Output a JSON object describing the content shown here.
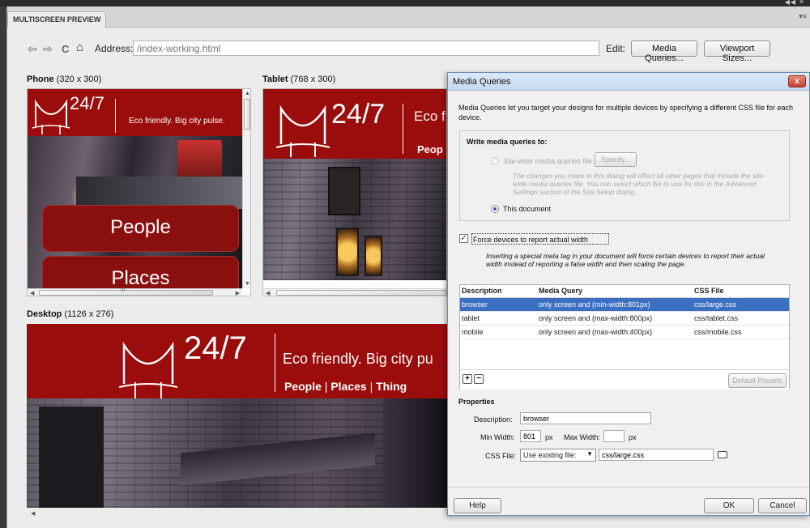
{
  "panel": {
    "tab_label": "MULTISCREEN PREVIEW",
    "window_controls": "◀◀ ✕",
    "panel_menu": "▾≡"
  },
  "toolbar": {
    "back_icon": "⇦",
    "forward_icon": "⇨",
    "refresh_icon": "C",
    "home_icon": "⌂",
    "address_label": "Address:",
    "address_value": "/index-working.html",
    "edit_label": "Edit:",
    "media_queries_button": "Media Queries...",
    "viewport_sizes_button": "Viewport Sizes..."
  },
  "previews": {
    "phone": {
      "name": "Phone",
      "size": "(320 x 300)"
    },
    "tablet": {
      "name": "Tablet",
      "size": "(768 x 300)"
    },
    "desktop": {
      "name": "Desktop",
      "size": "(1126 x 276)"
    }
  },
  "site": {
    "logo_text": "24/7",
    "tagline_phone": "Eco friendly. Big city pulse.",
    "tagline_tablet": "Eco f",
    "tagline_desktop": "Eco friendly. Big city pu",
    "people": "People",
    "places": "Places",
    "nav_people": "People",
    "nav_places": "Places",
    "nav_things": "Thing",
    "nav_people_tablet": "Peop",
    "hscroll_mark": "III"
  },
  "dialog": {
    "title": "Media Queries",
    "close": "x",
    "intro": "Media Queries let you target your designs for multiple devices by specifying a different CSS file for each device.",
    "write_heading": "Write media queries to:",
    "site_wide_label": "Site-wide media queries file:",
    "specify_button": "Specify...",
    "site_wide_note": "The changes you make in this dialog will affect all other pages that include the site-wide media queries file. You can select which file to use for this in the Advanced Settings section of the Site Setup dialog.",
    "this_document_label": "This document",
    "force_label": "Force devices to report actual width",
    "force_note": "Inserting a special meta tag in your document will force certain devices to report their actual width instead of reporting a false width and then scaling the page.",
    "table": {
      "headers": [
        "Description",
        "Media Query",
        "CSS File"
      ],
      "rows": [
        [
          "browser",
          "only screen and (min-width:801px)",
          "css/large.css"
        ],
        [
          "tablet",
          "only screen and (max-width:800px)",
          "css/tablet.css"
        ],
        [
          "mobile",
          "only screen and (max-width:400px)",
          "css/mobile.css"
        ]
      ]
    },
    "add_button": "+",
    "remove_button": "−",
    "default_presets_button": "Default Presets",
    "properties_heading": "Properties",
    "description_label": "Description:",
    "description_value": "browser",
    "min_width_label": "Min Width:",
    "min_width_value": "801",
    "px1": "px",
    "max_width_label": "Max Width:",
    "max_width_value": "",
    "px2": "px",
    "css_file_label": "CSS File:",
    "css_file_select": "Use existing file:",
    "css_file_value": "css/large.css",
    "help_button": "Help",
    "ok_button": "OK",
    "cancel_button": "Cancel"
  }
}
